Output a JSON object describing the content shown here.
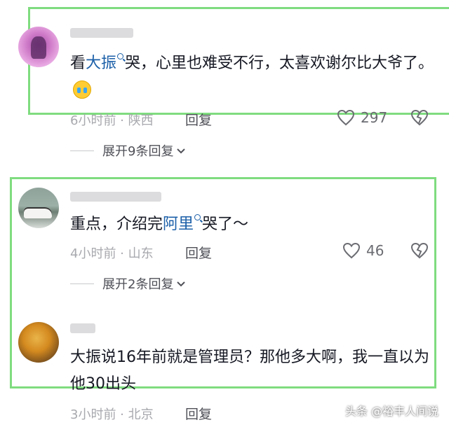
{
  "comments": [
    {
      "text_before": "看",
      "link": "大振",
      "text_after": "哭，心里也难受不行，太喜欢谢尔比大爷了。",
      "meta": "6小时前 · 陕西",
      "reply": "回复",
      "likes": "297",
      "expand": "展开9条回复"
    },
    {
      "text_before": "重点，介绍完",
      "link": "阿里",
      "text_after": "哭了～",
      "meta": "4小时前 · 山东",
      "reply": "回复",
      "likes": "46",
      "expand": "展开2条回复"
    },
    {
      "text": "大振说16年前就是管理员？那他多大啊，我一直以为他30出头",
      "meta": "3小时前 · 北京",
      "reply": "回复"
    }
  ],
  "watermark": "头条 @裕丰人间说",
  "colors": {
    "highlight_box": "#7fdc7f",
    "link": "#1b5fa8"
  }
}
